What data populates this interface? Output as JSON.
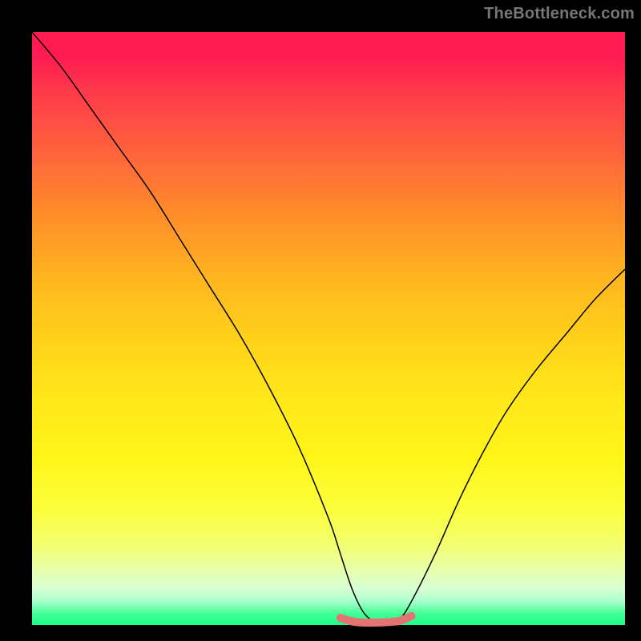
{
  "watermark": "TheBottleneck.com",
  "chart_data": {
    "type": "line",
    "title": "",
    "xlabel": "",
    "ylabel": "",
    "xlim": [
      0,
      100
    ],
    "ylim": [
      0,
      100
    ],
    "grid": false,
    "legend": false,
    "series": [
      {
        "name": "bottleneck-curve",
        "color": "#000000",
        "x": [
          0,
          5,
          10,
          15,
          20,
          25,
          30,
          35,
          40,
          45,
          50,
          52,
          54,
          56,
          58,
          60,
          62,
          64,
          68,
          72,
          76,
          80,
          85,
          90,
          95,
          100
        ],
        "y": [
          100,
          94,
          87,
          80,
          73,
          65,
          57,
          49,
          40,
          30,
          18,
          12,
          6,
          2,
          0.5,
          0.5,
          1,
          4,
          12,
          21,
          29,
          36,
          43,
          49,
          55,
          60
        ]
      },
      {
        "name": "optimal-band",
        "color": "#e57373",
        "x": [
          52,
          54,
          56,
          58,
          60,
          62,
          64
        ],
        "y": [
          1.2,
          0.6,
          0.4,
          0.4,
          0.5,
          0.7,
          1.5
        ]
      }
    ],
    "annotations": []
  },
  "colors": {
    "background_frame": "#000000",
    "gradient_top": "#ff1a52",
    "gradient_mid": "#ffe81a",
    "gradient_bottom": "#1aff88",
    "curve": "#000000",
    "optimal_band": "#e57373",
    "watermark": "#777777"
  }
}
